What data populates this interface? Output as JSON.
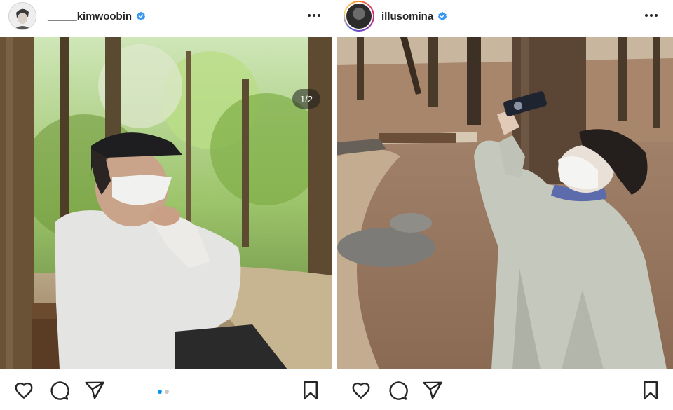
{
  "posts": [
    {
      "username": "_____kimwoobin",
      "verified": true,
      "media_counter": "1/2",
      "carousel": {
        "count": 2,
        "active_index": 0
      },
      "avatar_icon": "profile-photo-icon",
      "more_icon": "more-horizontal-icon",
      "actions": [
        "heart-icon",
        "comment-icon",
        "share-icon",
        "bookmark-icon"
      ]
    },
    {
      "username": "illusomina",
      "verified": true,
      "has_story_ring": true,
      "avatar_icon": "profile-photo-icon",
      "more_icon": "more-horizontal-icon",
      "actions": [
        "heart-icon",
        "comment-icon",
        "share-icon",
        "bookmark-icon"
      ]
    }
  ],
  "colors": {
    "verified_badge": "#3897f0",
    "carousel_active": "#0095f6",
    "carousel_inactive": "#c8c8c8",
    "text": "#262626"
  }
}
